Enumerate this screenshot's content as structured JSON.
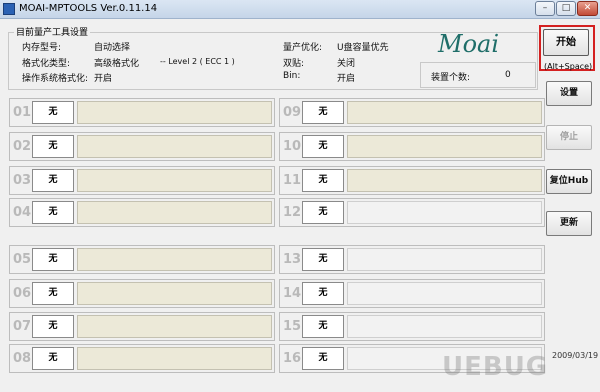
{
  "window": {
    "title": "MOAI-MPTOOLS Ver.0.11.14",
    "min": "–",
    "max": "□",
    "close": "✕"
  },
  "settings": {
    "legend": "目前量产工具设置",
    "memory_label": "内存型号:",
    "memory_value": "自动选择",
    "format_label": "格式化类型:",
    "format_value": "高级格式化",
    "format_level": "-- Level 2 ( ECC 1 )",
    "os_format_label": "操作系统格式化:",
    "os_format_value": "开启",
    "optimize_label": "量产优化:",
    "optimize_value": "U盘容量优先",
    "dual_label": "双贴:",
    "dual_value": "关闭",
    "bin_label": "Bin:",
    "bin_value": "开启",
    "count_label": "装置个数:",
    "count_value": "0"
  },
  "logo": {
    "text": "Moai"
  },
  "buttons": {
    "start": "开始",
    "start_hint": "(Alt+Space)",
    "settings": "设置",
    "stop": "停止",
    "reset_hub": "复位Hub",
    "update": "更新"
  },
  "date": "2009/03/19",
  "watermark": "UEBUG",
  "slots": [
    {
      "num": "01",
      "status": "无"
    },
    {
      "num": "02",
      "status": "无"
    },
    {
      "num": "03",
      "status": "无"
    },
    {
      "num": "04",
      "status": "无"
    },
    {
      "num": "05",
      "status": "无"
    },
    {
      "num": "06",
      "status": "无"
    },
    {
      "num": "07",
      "status": "无"
    },
    {
      "num": "08",
      "status": "无"
    },
    {
      "num": "09",
      "status": "无"
    },
    {
      "num": "10",
      "status": "无"
    },
    {
      "num": "11",
      "status": "无"
    },
    {
      "num": "12",
      "status": "无"
    },
    {
      "num": "13",
      "status": "无"
    },
    {
      "num": "14",
      "status": "无"
    },
    {
      "num": "15",
      "status": "无"
    },
    {
      "num": "16",
      "status": "无"
    }
  ],
  "colors": {
    "accent_outline": "#d42020",
    "progress_active": "#ece9d8",
    "logo": "#1f6e69"
  }
}
